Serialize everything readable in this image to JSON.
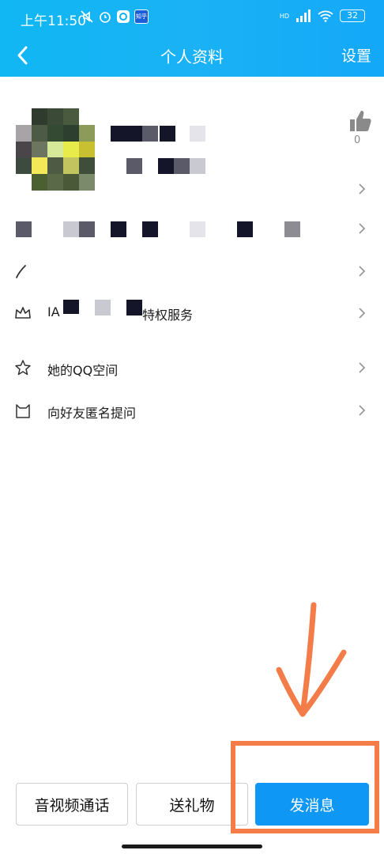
{
  "status_bar": {
    "time": "上午11:50",
    "app_badge": "知乎",
    "network": "HD",
    "battery": "32"
  },
  "nav": {
    "title": "个人资料",
    "settings_label": "设置"
  },
  "profile": {
    "like_count": "0"
  },
  "rows": {
    "vip_prefix": "IA",
    "vip_suffix": "特权服务",
    "qzone": "她的QQ空间",
    "anonymous_ask": "向好友匿名提问"
  },
  "actions": {
    "video_call": "音视频通话",
    "send_gift": "送礼物",
    "send_message": "发消息"
  },
  "colors": {
    "header": "#14b0f4",
    "primary_button": "#0f97f5",
    "annotation": "#f47c48"
  },
  "icons": [
    "back-arrow-icon",
    "thumbs-up-icon",
    "pen-icon",
    "crown-icon",
    "star-icon",
    "cat-icon",
    "chevron-right-icon"
  ]
}
